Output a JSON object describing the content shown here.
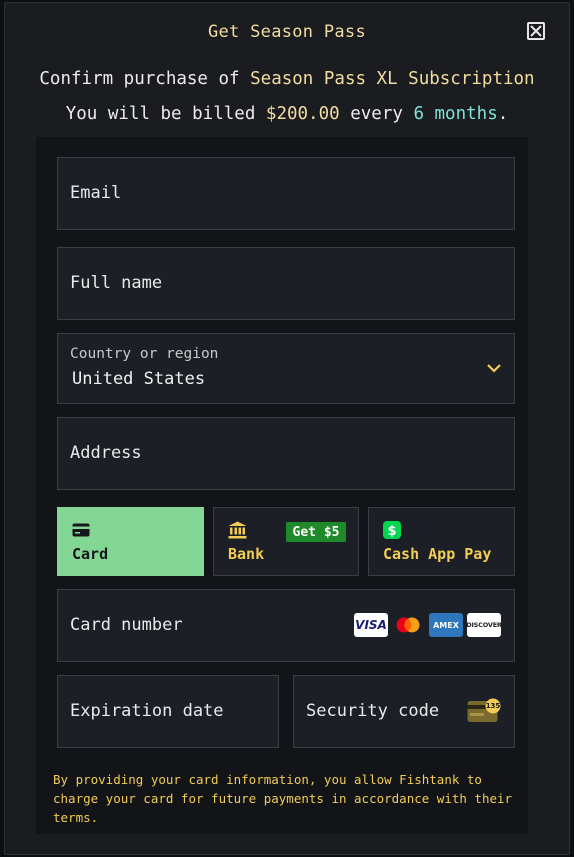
{
  "dialog": {
    "title": "Get Season Pass",
    "confirm_prefix": "Confirm purchase of",
    "product_name": "Season Pass XL Subscription",
    "billed_prefix": "You will be billed",
    "price": "$200.00",
    "every_word": "every",
    "period": "6 months",
    "period_suffix": "."
  },
  "form": {
    "email_label": "Email",
    "fullname_label": "Full name",
    "country_label": "Country or region",
    "country_value": "United States",
    "address_label": "Address",
    "card_number_label": "Card number",
    "expiration_label": "Expiration date",
    "security_label": "Security code",
    "security_badge": "135"
  },
  "payment_tabs": [
    {
      "label": "Card",
      "icon": "credit-card-icon",
      "active": true
    },
    {
      "label": "Bank",
      "icon": "bank-icon",
      "badge": "Get $5",
      "active": false
    },
    {
      "label": "Cash App Pay",
      "icon": "cash-app-icon",
      "active": false
    }
  ],
  "card_brands": {
    "visa": "VISA",
    "amex": "AMEX",
    "discover": "DISCOVER"
  },
  "disclaimer": "By providing your card information, you allow Fishtank to charge your card for future payments in accordance with their terms.",
  "colors": {
    "accent_yellow": "#f2cc55",
    "title_yellow": "#f2dca0",
    "accent_cyan": "#7fe3d6",
    "active_tab_green": "#84d695",
    "badge_green": "#1f8a2a"
  }
}
